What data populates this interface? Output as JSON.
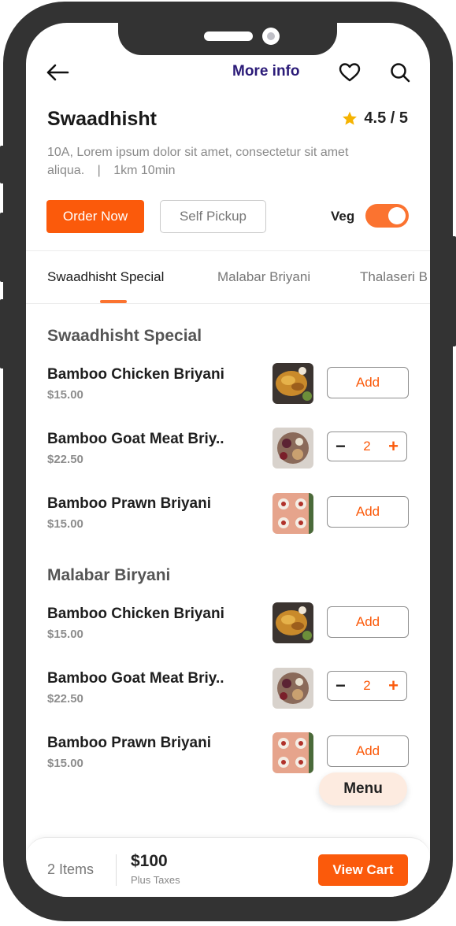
{
  "header": {
    "back_icon": "arrow-left-icon",
    "more_info_label": "More info",
    "favorite_icon": "heart-icon",
    "search_icon": "search-icon"
  },
  "restaurant": {
    "name": "Swaadhisht",
    "rating": "4.5 / 5",
    "address": "10A, Lorem ipsum dolor sit amet, consectetur sit amet aliqua.",
    "distance_time": "1km 10min"
  },
  "actions": {
    "order_now": "Order Now",
    "self_pickup": "Self Pickup",
    "veg_label": "Veg",
    "veg_on": true
  },
  "tabs": [
    {
      "label": "Swaadhisht Special",
      "active": true
    },
    {
      "label": "Malabar Briyani",
      "active": false
    },
    {
      "label": "Thalaseri B",
      "active": false
    }
  ],
  "sections": [
    {
      "title": "Swaadhisht Special",
      "items": [
        {
          "name": "Bamboo Chicken Briyani",
          "price": "$15.00",
          "action": "Add"
        },
        {
          "name": "Bamboo Goat Meat Briy..",
          "price": "$22.50",
          "qty": "2"
        },
        {
          "name": "Bamboo Prawn Briyani",
          "price": "$15.00",
          "action": "Add"
        }
      ]
    },
    {
      "title": "Malabar Biryani",
      "items": [
        {
          "name": "Bamboo Chicken Briyani",
          "price": "$15.00",
          "action": "Add"
        },
        {
          "name": "Bamboo Goat Meat Briy..",
          "price": "$22.50",
          "qty": "2"
        },
        {
          "name": "Bamboo Prawn Briyani",
          "price": "$15.00",
          "action": "Add"
        }
      ]
    }
  ],
  "stepper": {
    "minus": "−",
    "plus": "+"
  },
  "menu_button": "Menu",
  "cart": {
    "items": "2 Items",
    "total": "$100",
    "taxes": "Plus Taxes",
    "view_cart": "View Cart"
  },
  "colors": {
    "accent": "#fb5a0b",
    "more_info": "#2b1b78",
    "star": "#f5b301"
  }
}
